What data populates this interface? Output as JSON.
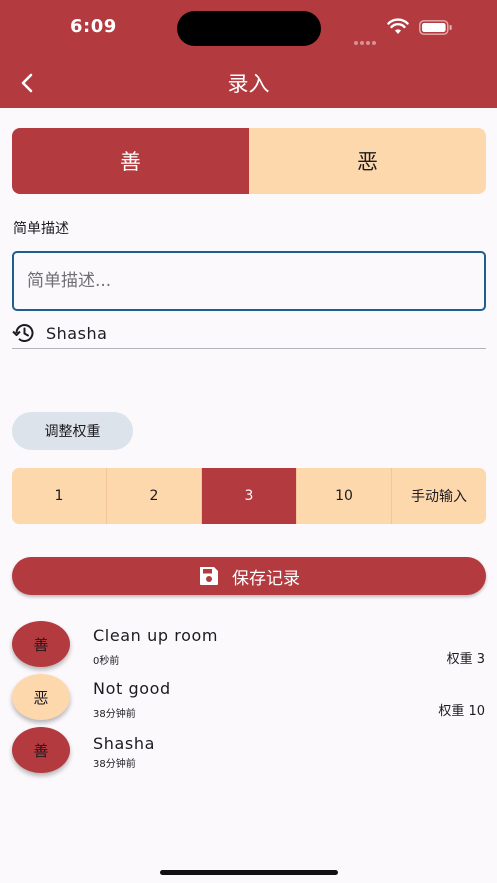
{
  "status_bar": {
    "time": "6:09"
  },
  "header": {
    "title": "录入",
    "back_icon": "chevron-left-icon"
  },
  "type_toggle": {
    "good_label": "善",
    "bad_label": "恶",
    "selected": "good"
  },
  "description": {
    "label": "简单描述",
    "placeholder": "简单描述...",
    "value": "",
    "suggestion": {
      "icon": "history-icon",
      "text": "Shasha"
    }
  },
  "weight": {
    "adjust_label": "调整权重",
    "options": [
      "1",
      "2",
      "3",
      "10",
      "手动输入"
    ],
    "selected": "3"
  },
  "save": {
    "label": "保存记录",
    "icon": "floppy-disk-icon"
  },
  "records": [
    {
      "badge": "善",
      "kind": "good",
      "title": "Clean up room",
      "time": "0秒前",
      "weight": "权重 3"
    },
    {
      "badge": "恶",
      "kind": "bad",
      "title": "Not good",
      "time": "38分钟前",
      "weight": "权重 10"
    },
    {
      "badge": "善",
      "kind": "good",
      "title": "Shasha",
      "time": "38分钟前",
      "weight": ""
    }
  ],
  "colors": {
    "primary": "#b33a3e",
    "secondary": "#fed8ad",
    "chip": "#dde3ea",
    "focus": "#1d5f8f"
  }
}
